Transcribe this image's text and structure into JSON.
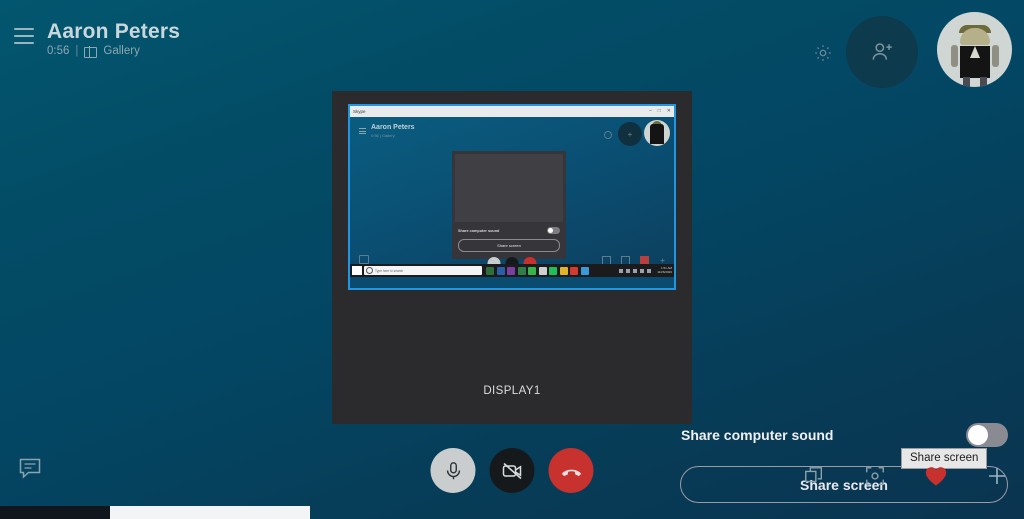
{
  "app": {
    "name": "Skype",
    "background_top": "#03566f",
    "background_bottom": "#0a3450"
  },
  "header": {
    "menu_icon": "hamburger-icon",
    "title": "Aaron Peters",
    "call_duration": "0:56",
    "divider": "|",
    "view_mode": "Gallery",
    "view_mode_icon": "gallery-grid-icon",
    "settings_icon": "gear-icon",
    "add_people_icon": "add-person-icon",
    "avatar_label": "Aaron Peters avatar"
  },
  "share_dialog": {
    "preview": {
      "label": "DISPLAY1",
      "selected": true,
      "selection_color": "#2196e3",
      "window_title": "Skype",
      "window_controls": [
        "–",
        "□",
        "✕"
      ],
      "inner": {
        "title": "Aaron Peters",
        "subtitle": "0:56 | Gallery",
        "panel": {
          "sound_label": "Share computer sound",
          "share_button": "Share screen"
        },
        "taskbar": {
          "search_placeholder": "Type here to search",
          "clock_time": "1:51 AM",
          "clock_date": "11/26/2020"
        }
      }
    },
    "sound_setting": {
      "label": "Share computer sound",
      "enabled": false
    },
    "primary_button": "Share screen",
    "tooltip": "Share screen",
    "panel_color": "#2b2b2e"
  },
  "call_controls": {
    "chat_icon": "chat-bubble-icon",
    "mic": {
      "icon": "microphone-icon",
      "state": "unmuted",
      "color": "#c9cdce"
    },
    "camera": {
      "icon": "camera-off-icon",
      "state": "off",
      "color": "#15191c"
    },
    "end_call": {
      "icon": "end-call-icon",
      "color": "#c7312e"
    },
    "right_icons": [
      {
        "name": "share-screen-icon",
        "label": "Share screen"
      },
      {
        "name": "snapshot-icon",
        "label": "Take snapshot"
      },
      {
        "name": "heart-reaction-icon",
        "label": "Send reaction",
        "color": "#c7312e"
      },
      {
        "name": "plus-icon",
        "label": "More"
      }
    ]
  }
}
